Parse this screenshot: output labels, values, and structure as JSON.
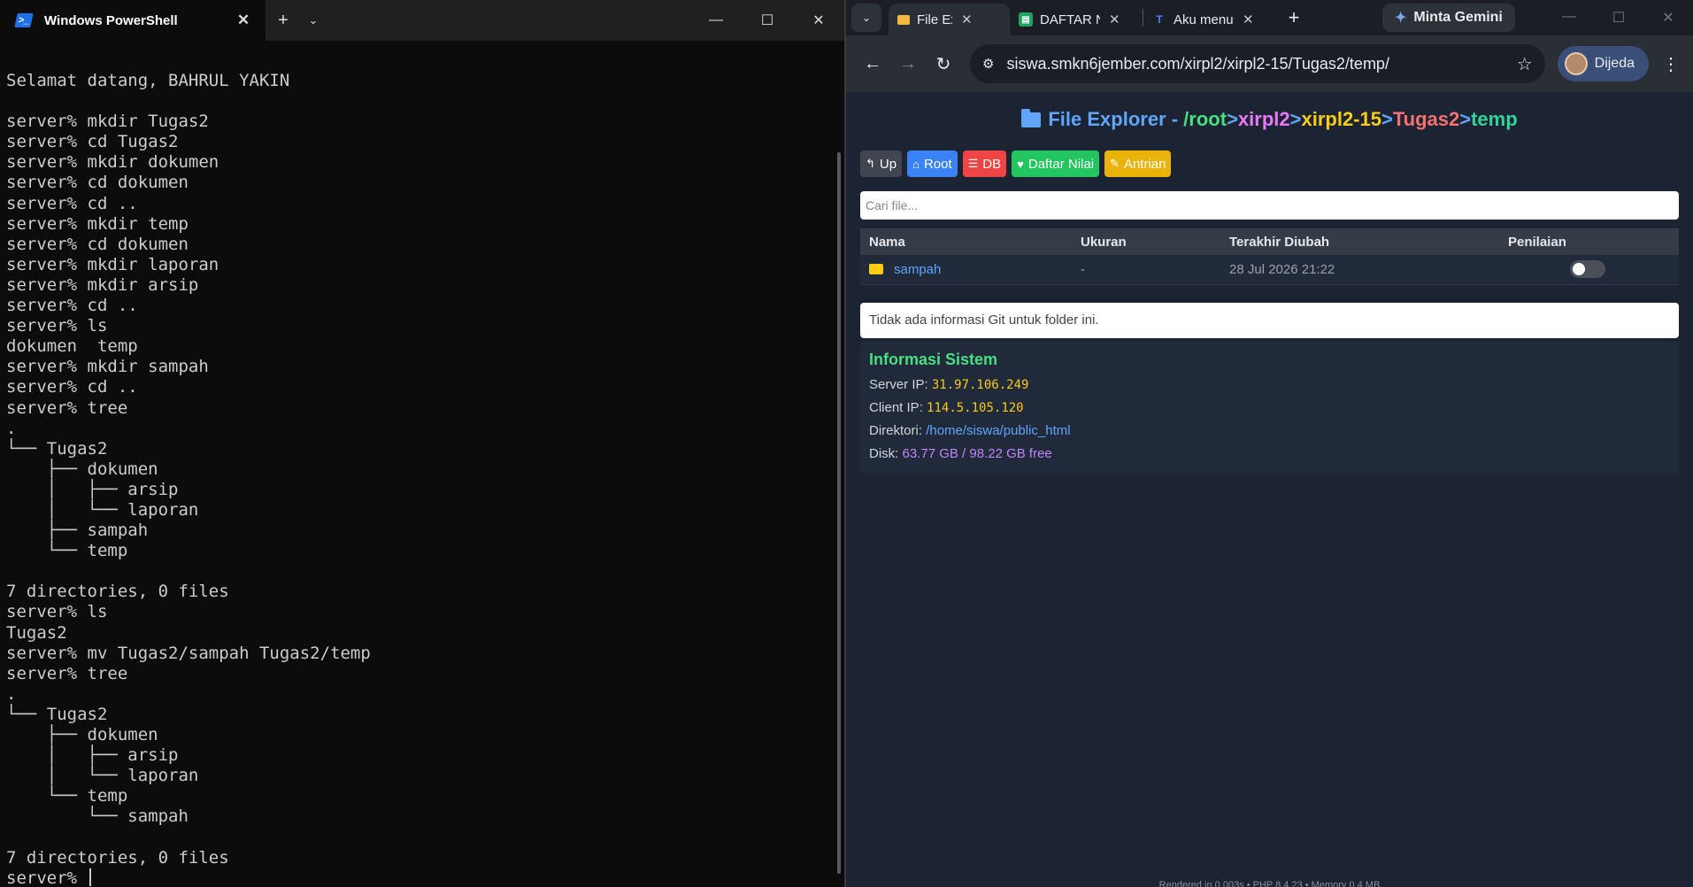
{
  "powershell": {
    "title": "Windows PowerShell",
    "icon": "powershell-icon",
    "lines": [
      "Selamat datang, BAHRUL YAKIN",
      "",
      "server% mkdir Tugas2",
      "server% cd Tugas2",
      "server% mkdir dokumen",
      "server% cd dokumen",
      "server% cd ..",
      "server% mkdir temp",
      "server% cd dokumen",
      "server% mkdir laporan",
      "server% mkdir arsip",
      "server% cd ..",
      "server% ls",
      "dokumen  temp",
      "server% mkdir sampah",
      "server% cd ..",
      "server% tree",
      ".",
      "└── Tugas2",
      "    ├── dokumen",
      "    │   ├── arsip",
      "    │   └── laporan",
      "    ├── sampah",
      "    └── temp",
      "",
      "7 directories, 0 files",
      "server% ls",
      "Tugas2",
      "server% mv Tugas2/sampah Tugas2/temp",
      "server% tree",
      ".",
      "└── Tugas2",
      "    ├── dokumen",
      "    │   ├── arsip",
      "    │   └── laporan",
      "    └── temp",
      "        └── sampah",
      "",
      "7 directories, 0 files"
    ],
    "prompt": "server% "
  },
  "browser": {
    "tabs": [
      {
        "label": "File Explorer",
        "favicon": "folder-icon",
        "active": true
      },
      {
        "label": "DAFTAR NILAI",
        "favicon": "sheets-icon",
        "active": false
      },
      {
        "label": "Aku menulis",
        "favicon": "typing-icon",
        "active": false
      }
    ],
    "gemini_label": "Minta Gemini",
    "url": "siswa.smkn6jember.com/xirpl2/xirpl2-15/Tugas2/temp/",
    "profile_name": "Dijeda"
  },
  "page": {
    "title_prefix": "File Explorer - ",
    "path": {
      "root": "/root",
      "sep": ">",
      "seg1": "xirpl2",
      "seg2": "xirpl2-15",
      "seg3": "Tugas2",
      "seg4": "temp"
    },
    "buttons": {
      "up": "Up",
      "root": "Root",
      "db": "DB",
      "nilai": "Daftar Nilai",
      "antrian": "Antrian"
    },
    "search_placeholder": "Cari file...",
    "table": {
      "headers": [
        "Nama",
        "Ukuran",
        "Terakhir Diubah",
        "Penilaian"
      ],
      "rows": [
        {
          "name": "sampah",
          "size": "-",
          "modified": "28 Jul 2026 21:22",
          "graded": false
        }
      ]
    },
    "git_info": "Tidak ada informasi Git untuk folder ini.",
    "sysinfo": {
      "title": "Informasi Sistem",
      "server_ip_label": "Server IP: ",
      "server_ip": "31.97.106.249",
      "client_ip_label": "Client IP: ",
      "client_ip": "114.5.105.120",
      "dir_label": "Direktori: ",
      "dir": "/home/siswa/public_html",
      "disk_label": "Disk: ",
      "disk": "63.77 GB / 98.22 GB free"
    },
    "footer": "Rendered in 0.003s • PHP 8.4.23 • Memory 0.4 MB"
  },
  "colors": {
    "accent_blue": "#3b82f6",
    "accent_red": "#ef4444",
    "accent_green": "#22c55e",
    "accent_yellow": "#eab308",
    "page_bg": "#1c2434"
  }
}
